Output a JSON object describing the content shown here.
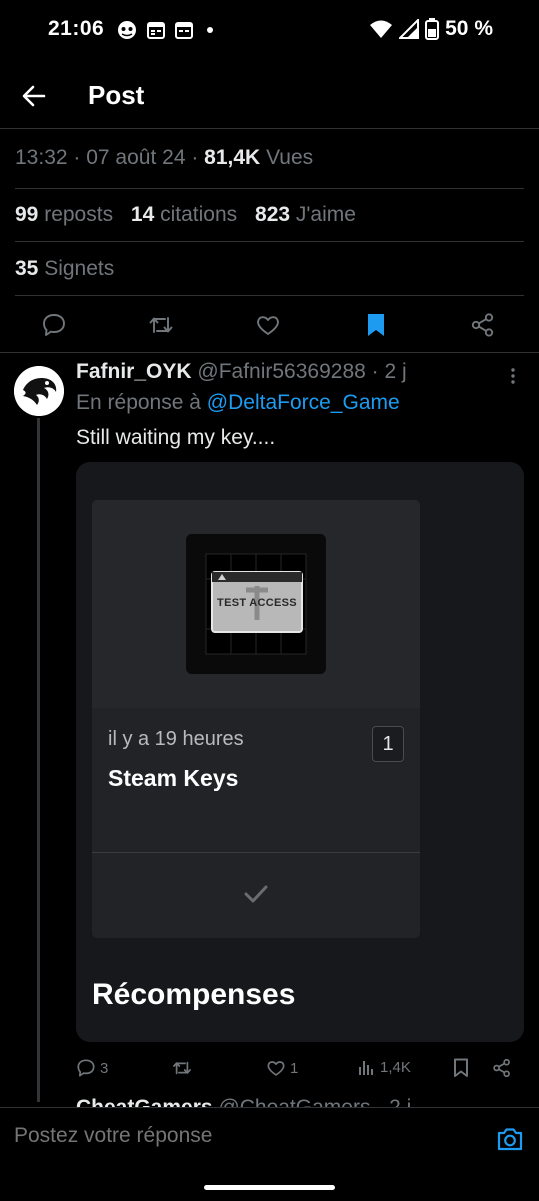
{
  "status_bar": {
    "time": "21:06",
    "battery": "50 %",
    "icons": [
      "discord-icon",
      "calendar-icon",
      "calendar-icon",
      "dot-icon",
      "wifi-icon",
      "signal-icon",
      "battery-icon"
    ]
  },
  "header": {
    "title": "Post"
  },
  "post_meta": {
    "time": "13:32",
    "date": "07 août 24",
    "views_count": "81,4K",
    "views_label": "Vues"
  },
  "stats": {
    "reposts_count": "99",
    "reposts_label": "reposts",
    "quotes_count": "14",
    "quotes_label": "citations",
    "likes_count": "823",
    "likes_label": "J'aime",
    "bookmarks_count": "35",
    "bookmarks_label": "Signets"
  },
  "reply": {
    "name": "Fafnir_OYK",
    "handle": "@Fafnir56369288",
    "age": "2 j",
    "reply_prefix": "En réponse à",
    "reply_to": "@DeltaForce_Game",
    "text": "Still waiting my key....",
    "media": {
      "thumb_text": "TEST ACCESS",
      "card_time": "il y a 19 heures",
      "card_badge": "1",
      "card_title": "Steam Keys",
      "section_title": "Récompenses"
    },
    "actions": {
      "replies": "3",
      "likes": "1",
      "views": "1,4K"
    }
  },
  "next_reply": {
    "name": "CheatGamers",
    "handle": "@CheatGamers",
    "age": "2 j"
  },
  "compose": {
    "placeholder": "Postez votre réponse"
  },
  "colors": {
    "accent": "#1d9bf0",
    "muted": "#71767b",
    "text": "#e7e9ea",
    "border": "#2f3336"
  }
}
